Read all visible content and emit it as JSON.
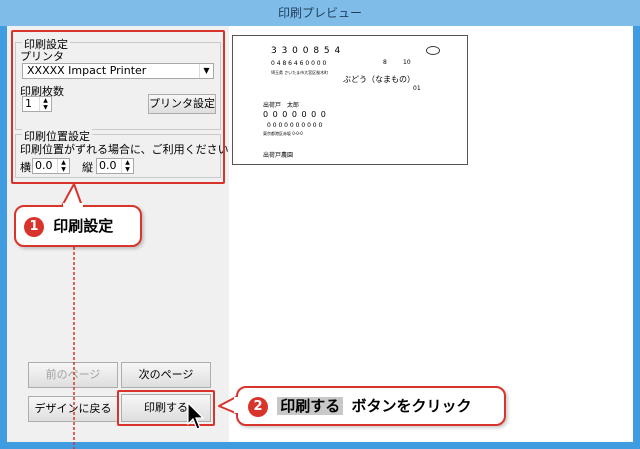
{
  "window": {
    "title": "印刷プレビュー"
  },
  "print_settings": {
    "legend": "印刷設定",
    "printer_label": "プリンタ",
    "printer_value": "XXXXX Impact Printer",
    "copies_label": "印刷枚数",
    "copies_value": "1",
    "printer_settings_button": "プリンタ設定"
  },
  "position_settings": {
    "legend": "印刷位置設定",
    "note": "印刷位置がずれる場合に、ご利用ください。",
    "horizontal_label": "横",
    "horizontal_value": "0.0",
    "vertical_label": "縦",
    "vertical_value": "0.0"
  },
  "buttons": {
    "prev_page": "前のページ",
    "next_page": "次のページ",
    "back_to_design": "デザインに戻る",
    "print": "印刷する"
  },
  "preview": {
    "postal_code": "3 3 0 0 8 5 4",
    "phone": "0 4 8   6 4 6   0 0 0 0",
    "address_small": "埼玉県 さいたま市大宮区桜木町",
    "number_8": "8",
    "number_10": "10",
    "recipient": "ぶどう（なまもの）",
    "number_01": "01",
    "sender_name": "出荷戸　太郎",
    "sender_digits_1": "0 0 0 0 0 0 0",
    "sender_digits_2": "0 0   0 0 0 0   0 0 0 0",
    "sender_address_small": "東京都港区赤坂 0-0-0",
    "sender_farm": "出荷戸農園"
  },
  "callouts": {
    "c1_number": "1",
    "c1_text": "印刷設定",
    "c2_number": "2",
    "c2_tag": "印刷する",
    "c2_text": "ボタンをクリック"
  },
  "colors": {
    "accent": "#d9342b",
    "titlebar": "#7fbde8"
  },
  "icons": {
    "dropdown": "chevron-down-icon",
    "spin": "spin-arrows-icon",
    "cursor": "mouse-pointer-icon"
  }
}
